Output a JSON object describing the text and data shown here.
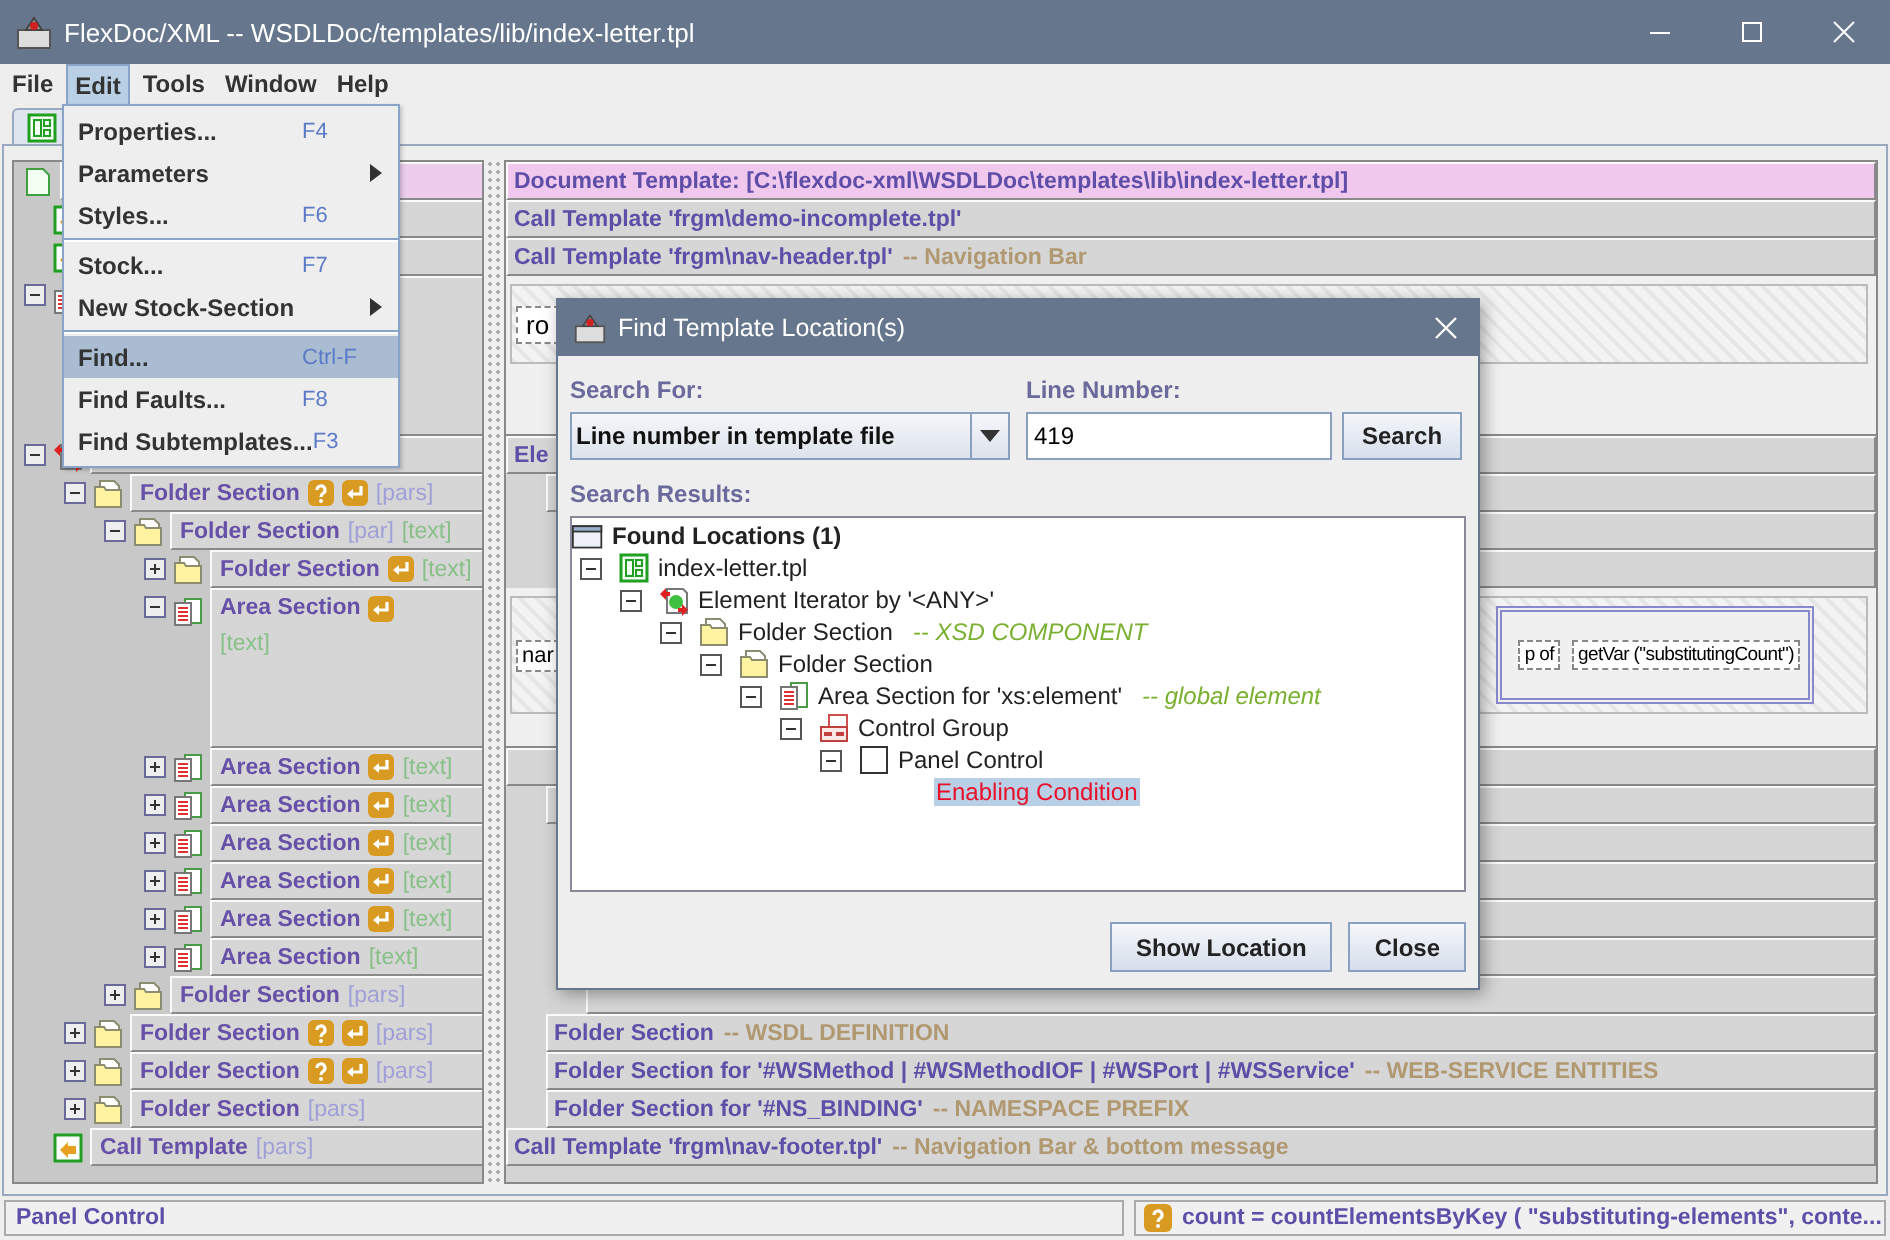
{
  "window": {
    "title": "FlexDoc/XML -- WSDLDoc/templates/lib/index-letter.tpl"
  },
  "menu_bar": [
    {
      "label": "File",
      "selected": false
    },
    {
      "label": "Edit",
      "selected": true
    },
    {
      "label": "Tools",
      "selected": false
    },
    {
      "label": "Window",
      "selected": false
    },
    {
      "label": "Help",
      "selected": false
    }
  ],
  "edit_menu": [
    {
      "kind": "item",
      "label": "Properties...",
      "shortcut": "F4",
      "selected": false
    },
    {
      "kind": "submenu",
      "label": "Parameters",
      "selected": false
    },
    {
      "kind": "item",
      "label": "Styles...",
      "shortcut": "F6",
      "selected": false
    },
    {
      "kind": "separator"
    },
    {
      "kind": "item",
      "label": "Stock...",
      "shortcut": "F7",
      "selected": false
    },
    {
      "kind": "submenu",
      "label": "New Stock-Section",
      "selected": false
    },
    {
      "kind": "separator"
    },
    {
      "kind": "item",
      "label": "Find...",
      "shortcut": "Ctrl-F",
      "selected": true
    },
    {
      "kind": "item",
      "label": "Find Faults...",
      "shortcut": "F8",
      "selected": false
    },
    {
      "kind": "item",
      "label": "Find Subtemplates...",
      "shortcut": "F3",
      "selected": false
    }
  ],
  "left_tree": [
    {
      "kind": "template",
      "children": [
        {
          "kind": "call"
        },
        {
          "kind": "call"
        },
        {
          "kind": "area",
          "expanded": true
        },
        {
          "kind": "iterator",
          "expanded": true,
          "children": [
            {
              "kind": "folder",
              "label": "Folder Section",
              "badges": [
                {
                  "kind": "question"
                },
                {
                  "kind": "return"
                }
              ],
              "tags": [
                {
                  "text": "[pars]",
                  "kind": "par"
                }
              ],
              "expanded": true,
              "children": [
                {
                  "kind": "folder",
                  "label": "Folder Section",
                  "tags": [
                    {
                      "text": "[par]",
                      "kind": "par"
                    },
                    {
                      "text": "[text]",
                      "kind": "text"
                    }
                  ],
                  "expanded": true,
                  "children": [
                    {
                      "kind": "folder",
                      "label": "Folder Section",
                      "badges": [
                        {
                          "kind": "return"
                        }
                      ],
                      "tags": [
                        {
                          "text": "[text]",
                          "kind": "text"
                        }
                      ],
                      "expanded": false
                    },
                    {
                      "kind": "area",
                      "label": "Area Section",
                      "badges": [
                        {
                          "kind": "return"
                        }
                      ],
                      "tags": [
                        {
                          "text": "[text]",
                          "kind": "text"
                        }
                      ],
                      "expanded": true
                    },
                    {
                      "kind": "area",
                      "label": "Area Section",
                      "badges": [
                        {
                          "kind": "return"
                        }
                      ],
                      "tags": [
                        {
                          "text": "[text]",
                          "kind": "text"
                        }
                      ],
                      "expanded": false
                    },
                    {
                      "kind": "area",
                      "label": "Area Section",
                      "badges": [
                        {
                          "kind": "return"
                        }
                      ],
                      "tags": [
                        {
                          "text": "[text]",
                          "kind": "text"
                        }
                      ],
                      "expanded": false
                    },
                    {
                      "kind": "area",
                      "label": "Area Section",
                      "badges": [
                        {
                          "kind": "return"
                        }
                      ],
                      "tags": [
                        {
                          "text": "[text]",
                          "kind": "text"
                        }
                      ],
                      "expanded": false
                    },
                    {
                      "kind": "area",
                      "label": "Area Section",
                      "badges": [
                        {
                          "kind": "return"
                        }
                      ],
                      "tags": [
                        {
                          "text": "[text]",
                          "kind": "text"
                        }
                      ],
                      "expanded": false
                    },
                    {
                      "kind": "area",
                      "label": "Area Section",
                      "badges": [
                        {
                          "kind": "return"
                        }
                      ],
                      "tags": [
                        {
                          "text": "[text]",
                          "kind": "text"
                        }
                      ],
                      "expanded": false
                    },
                    {
                      "kind": "area",
                      "label": "Area Section",
                      "tags": [
                        {
                          "text": "[text]",
                          "kind": "text"
                        }
                      ],
                      "expanded": false
                    }
                  ]
                },
                {
                  "kind": "folder",
                  "label": "Folder Section",
                  "tags": [
                    {
                      "text": "[pars]",
                      "kind": "par"
                    }
                  ],
                  "expanded": false
                }
              ]
            },
            {
              "kind": "folder",
              "label": "Folder Section",
              "badges": [
                {
                  "kind": "question"
                },
                {
                  "kind": "return"
                }
              ],
              "tags": [
                {
                  "text": "[pars]",
                  "kind": "par"
                }
              ],
              "expanded": false
            },
            {
              "kind": "folder",
              "label": "Folder Section",
              "badges": [
                {
                  "kind": "question"
                },
                {
                  "kind": "return"
                }
              ],
              "tags": [
                {
                  "text": "[pars]",
                  "kind": "par"
                }
              ],
              "expanded": false
            },
            {
              "kind": "folder",
              "label": "Folder Section",
              "tags": [
                {
                  "text": "[pars]",
                  "kind": "par"
                }
              ],
              "expanded": false
            }
          ]
        },
        {
          "kind": "call",
          "label": "Call Template",
          "tags": [
            {
              "text": "[pars]",
              "kind": "par"
            }
          ]
        }
      ]
    }
  ],
  "right_rows": [
    {
      "kind": "header",
      "label": "Document Template: [C:\\flexdoc-xml\\WSDLDoc\\templates\\lib\\index-letter.tpl]"
    },
    {
      "kind": "row",
      "label": "Call Template 'frgm\\demo-incomplete.tpl'"
    },
    {
      "kind": "row",
      "label": "Call Template 'frgm\\nav-header.tpl'",
      "comment": "-- Navigation Bar"
    },
    {
      "kind": "block",
      "fields": [
        "ro"
      ]
    },
    {
      "kind": "row",
      "label": "Ele",
      "children": [
        {
          "kind": "row",
          "children": [
            {
              "kind": "row"
            },
            {
              "kind": "row"
            }
          ]
        }
      ]
    },
    {
      "kind": "block",
      "fields": [
        "nar",
        "p of",
        "getVar (\"substitutingCount\")"
      ]
    },
    {
      "kind": "row",
      "children": [
        {
          "kind": "row",
          "children": [
            {
              "kind": "row"
            },
            {
              "kind": "row"
            },
            {
              "kind": "row"
            },
            {
              "kind": "row"
            },
            {
              "kind": "row"
            }
          ]
        },
        {
          "kind": "row",
          "label": "Folder Section",
          "comment": "-- WSDL DEFINITION"
        },
        {
          "kind": "row",
          "label": "Folder Section for '#WSMethod | #WSMethodIOF | #WSPort | #WSService'",
          "comment": "-- WEB-SERVICE ENTITIES"
        },
        {
          "kind": "row",
          "label": "Folder Section for '#NS_BINDING'",
          "comment": "-- NAMESPACE PREFIX"
        }
      ]
    },
    {
      "kind": "row",
      "label": "Call Template 'frgm\\nav-footer.tpl'",
      "comment": "-- Navigation Bar & bottom message"
    }
  ],
  "status_bar": {
    "left": "Panel Control",
    "right": "count = countElementsByKey ( \"substituting-elements\", conte..."
  },
  "dialog": {
    "title": "Find Template Location(s)",
    "search_for_label": "Search For:",
    "search_for_value": "Line number in template file",
    "line_number_label": "Line Number:",
    "line_number_value": "419",
    "search_button": "Search",
    "results_label": "Search Results:",
    "results": [
      {
        "kind": "root",
        "label": "Found Locations (1)",
        "selected": false,
        "children": [
          {
            "kind": "template",
            "label": "index-letter.tpl",
            "expanded": true,
            "selected": false,
            "children": [
              {
                "kind": "iterator",
                "label": "Element Iterator by '<ANY>'",
                "expanded": true,
                "selected": false,
                "children": [
                  {
                    "kind": "folder",
                    "label": "Folder Section",
                    "comment": "-- XSD COMPONENT",
                    "expanded": true,
                    "selected": false,
                    "children": [
                      {
                        "kind": "folder",
                        "label": "Folder Section",
                        "expanded": true,
                        "selected": false,
                        "children": [
                          {
                            "kind": "area",
                            "label": "Area Section for 'xs:element'",
                            "comment": "-- global element",
                            "expanded": true,
                            "selected": false,
                            "children": [
                              {
                                "kind": "group",
                                "label": "Control Group",
                                "expanded": true,
                                "selected": false,
                                "children": [
                                  {
                                    "kind": "panel",
                                    "label": "Panel Control",
                                    "expanded": true,
                                    "selected": false,
                                    "children": [
                                      {
                                        "kind": "condition",
                                        "label": "Enabling Condition",
                                        "selected": true
                                      }
                                    ]
                                  }
                                ]
                              }
                            ]
                          }
                        ]
                      }
                    ]
                  }
                ]
              }
            ]
          }
        ]
      }
    ],
    "buttons": [
      "Show Location",
      "Close"
    ]
  }
}
